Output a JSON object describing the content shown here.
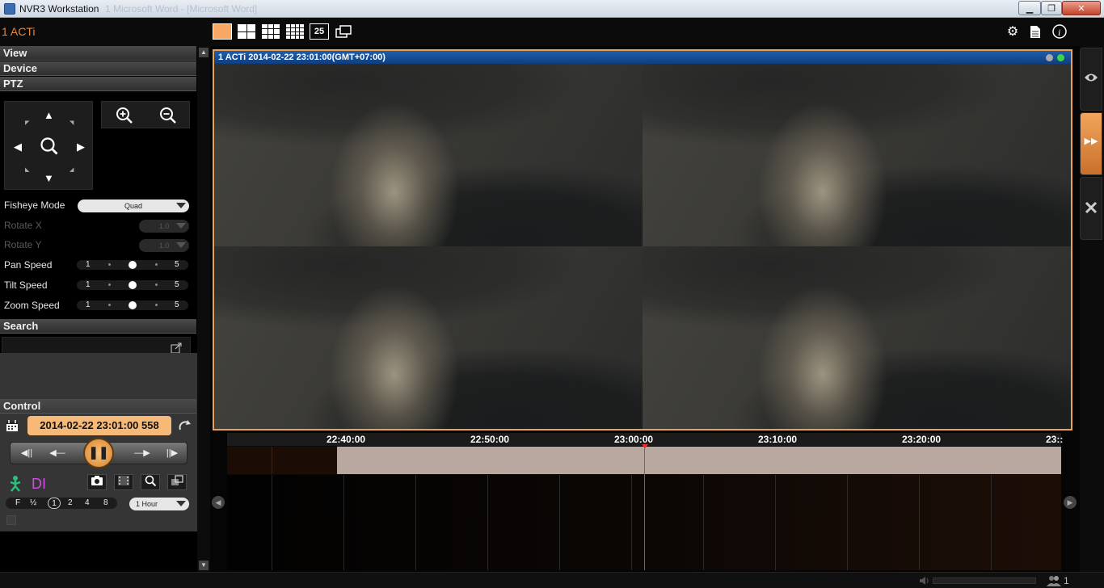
{
  "window": {
    "title": "NVR3 Workstation",
    "ghost_title": "1 Microsoft Word - [Microsoft Word]"
  },
  "topbar": {
    "site_name": "1 ACTi",
    "layout_buttons": [
      "1x1",
      "2x2",
      "3x3",
      "4x4",
      "25",
      "custom"
    ],
    "layout_25_label": "25",
    "icons": [
      "settings-icon",
      "document-icon",
      "info-icon"
    ]
  },
  "left": {
    "sections": {
      "view": "View",
      "device": "Device",
      "ptz": "PTZ",
      "search": "Search",
      "control": "Control"
    },
    "ptz": {
      "fisheye_label": "Fisheye Mode",
      "fisheye_value": "Quad",
      "rotate_x_label": "Rotate X",
      "rotate_x_value": "1.0",
      "rotate_y_label": "Rotate Y",
      "rotate_y_value": "1.0",
      "pan_speed_label": "Pan Speed",
      "tilt_speed_label": "Tilt Speed",
      "zoom_speed_label": "Zoom Speed",
      "speed_min": "1",
      "speed_max": "5",
      "speed_value": 3
    },
    "control": {
      "datetime": "2014-02-22 23:01:00 558",
      "di_label": "DI",
      "speeds": [
        "F",
        "½",
        "1",
        "2",
        "4",
        "8"
      ],
      "selected_speed": "1",
      "range_value": "1 Hour"
    }
  },
  "video": {
    "header": "1 ACTi   2014-02-22 23:01:00(GMT+07:00)"
  },
  "timeline": {
    "ticks": [
      "22:40:00",
      "22:50:00",
      "23:00:00",
      "23:10:00",
      "23:20:00",
      "23::"
    ],
    "cursor_time": "23:01:00"
  },
  "status": {
    "user_count": "1"
  }
}
